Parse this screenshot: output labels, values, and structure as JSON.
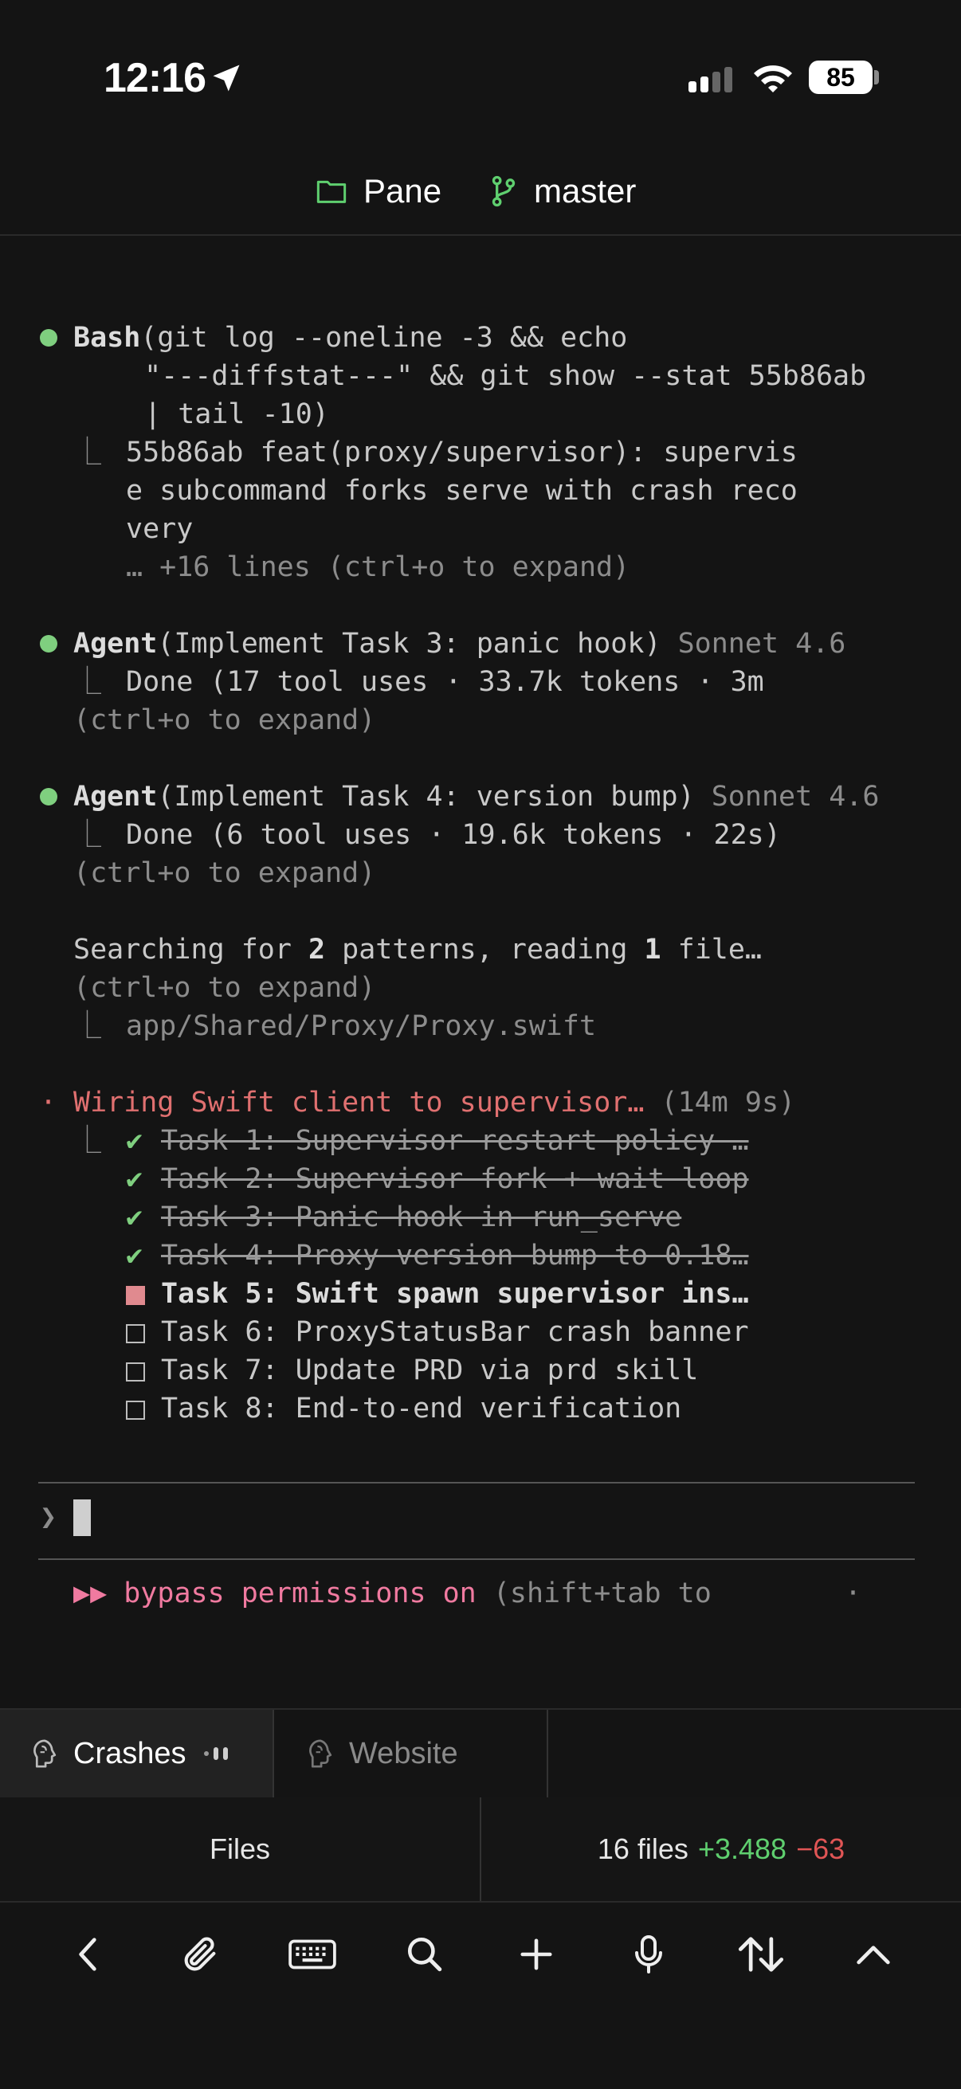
{
  "status_bar": {
    "time": "12:16",
    "battery": "85"
  },
  "header": {
    "project": "Pane",
    "branch": "master"
  },
  "terminal": {
    "bash": {
      "tool": "Bash",
      "line1": "(git log --oneline -3 && echo",
      "line2": " \"---diffstat---\" && git show --stat 55b86ab",
      "line3": " | tail -10)",
      "out1": "55b86ab feat(proxy/supervisor): supervis",
      "out2": "e subcommand forks serve with crash reco",
      "out3": "very",
      "more": "… +16 lines (ctrl+o to expand)"
    },
    "agent1": {
      "tool": "Agent",
      "args": "(Implement Task 3: panic hook)",
      "model": "Sonnet 4.6",
      "result": "Done (17 tool uses · 33.7k tokens · 3m",
      "expand": "(ctrl+o to expand)"
    },
    "agent2": {
      "tool": "Agent",
      "args": "(Implement Task 4: version bump)",
      "model": "Sonnet 4.6",
      "result": "Done (6 tool uses · 19.6k tokens · 22s)",
      "expand": "(ctrl+o to expand)"
    },
    "search": {
      "p1": "Searching for ",
      "n1": "2",
      "p2": " patterns, reading ",
      "n2": "1",
      "p3": " file…",
      "expand": "(ctrl+o to expand)",
      "file": "app/Shared/Proxy/Proxy.swift"
    },
    "progress": {
      "title": "Wiring Swift client to supervisor…",
      "elapsed": "(14m 9s)",
      "tasks": [
        {
          "label": "Task 1: Supervisor restart policy …",
          "status": "done"
        },
        {
          "label": "Task 2: Supervisor fork + wait loop",
          "status": "done"
        },
        {
          "label": "Task 3: Panic hook in run_serve",
          "status": "done"
        },
        {
          "label": "Task 4: Proxy version bump to 0.18…",
          "status": "done"
        },
        {
          "label": "Task 5: Swift spawn supervisor ins…",
          "status": "in-progress"
        },
        {
          "label": "Task 6: ProxyStatusBar crash banner",
          "status": "pending"
        },
        {
          "label": "Task 7: Update PRD via prd skill",
          "status": "pending"
        },
        {
          "label": "Task 8: End-to-end verification",
          "status": "pending"
        }
      ]
    },
    "prompt_symbol": "❯",
    "mode": {
      "arrows": "▶▶",
      "text": "bypass permissions on",
      "hint": "(shift+tab to",
      "dot": "·"
    }
  },
  "tabs": [
    {
      "label": "Crashes",
      "active": true
    },
    {
      "label": "Website",
      "active": false
    }
  ],
  "files_bar": {
    "files_label": "Files",
    "count": "16 files",
    "added": "+3.488",
    "removed": "−63"
  },
  "colors": {
    "accent_green": "#7fcf7f",
    "diff_add": "#5fcf6f",
    "diff_del": "#e05555",
    "progress_red": "#e07070",
    "mode_pink": "#f07aa0"
  }
}
